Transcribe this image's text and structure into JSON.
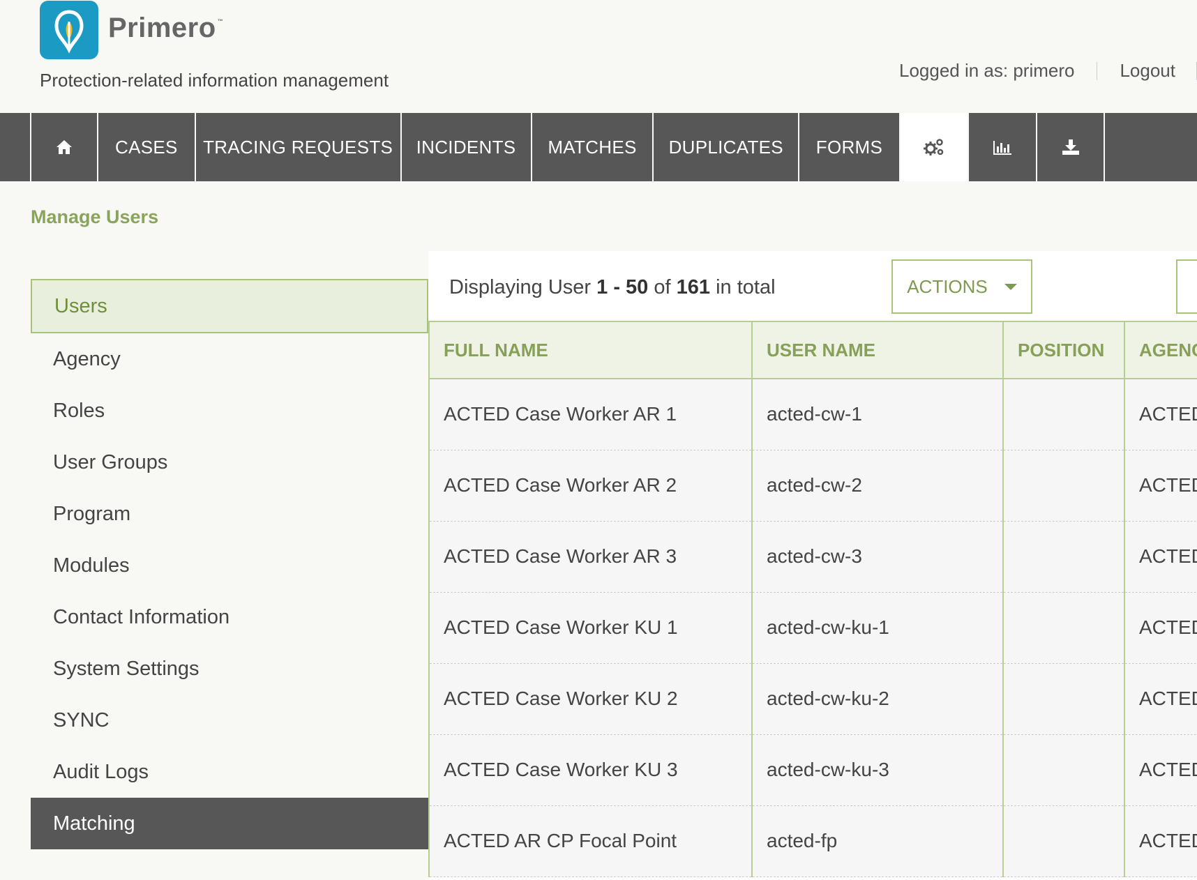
{
  "header": {
    "brand": "Primero",
    "brand_tm": "™",
    "tagline": "Protection-related information management",
    "logged_in": "Logged in as: primero",
    "logout": "Logout"
  },
  "nav": {
    "home_icon": "home-icon",
    "cases": "CASES",
    "tracing_requests": "TRACING REQUESTS",
    "incidents": "INCIDENTS",
    "matches": "MATCHES",
    "duplicates": "DUPLICATES",
    "forms": "FORMS",
    "settings_icon": "gears-icon",
    "reports_icon": "bar-chart-icon",
    "export_icon": "download-icon"
  },
  "breadcrumb": "Manage Users",
  "sidebar": {
    "items": [
      "Users",
      "Agency",
      "Roles",
      "User Groups",
      "Program",
      "Modules",
      "Contact Information",
      "System Settings",
      "SYNC",
      "Audit Logs",
      "Matching"
    ]
  },
  "summary": {
    "prefix": "Displaying User",
    "range": "1 - 50",
    "of": "of",
    "total": "161",
    "suffix": "in total"
  },
  "actions_label": "ACTIONS",
  "table": {
    "columns": [
      "FULL NAME",
      "USER NAME",
      "POSITION",
      "AGENCY"
    ],
    "rows": [
      [
        "ACTED Case Worker AR 1",
        "acted-cw-1",
        "",
        "ACTED"
      ],
      [
        "ACTED Case Worker AR 2",
        "acted-cw-2",
        "",
        "ACTED"
      ],
      [
        "ACTED Case Worker AR 3",
        "acted-cw-3",
        "",
        "ACTED"
      ],
      [
        "ACTED Case Worker KU 1",
        "acted-cw-ku-1",
        "",
        "ACTED"
      ],
      [
        "ACTED Case Worker KU 2",
        "acted-cw-ku-2",
        "",
        "ACTED"
      ],
      [
        "ACTED Case Worker KU 3",
        "acted-cw-ku-3",
        "",
        "ACTED"
      ],
      [
        "ACTED AR CP Focal Point",
        "acted-fp",
        "",
        "ACTED"
      ]
    ]
  },
  "colors": {
    "accent_green": "#8aa45e",
    "nav_bg": "#575757",
    "logo_blue": "#1b9bc4"
  }
}
